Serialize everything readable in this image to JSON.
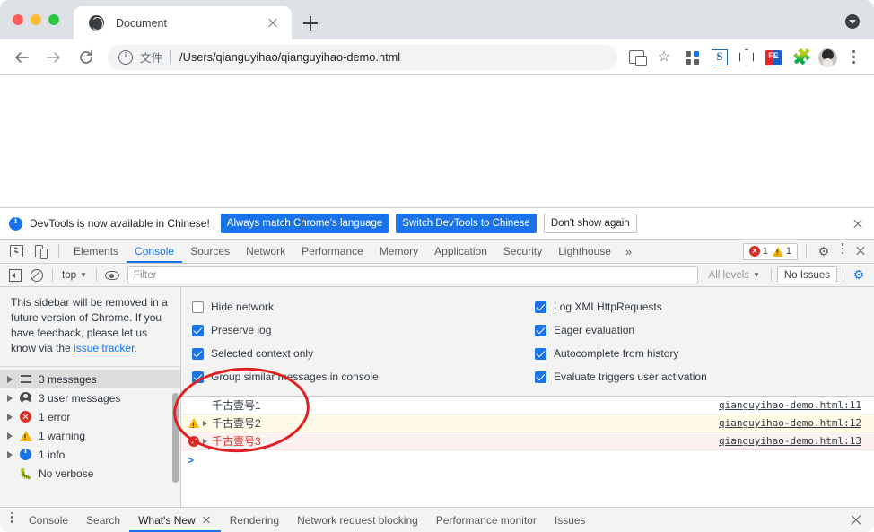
{
  "browser": {
    "tab": {
      "title": "Document",
      "favicon": "globe-icon",
      "close": "×"
    },
    "new_tab": "+",
    "window_menu": "window-menu-icon",
    "nav": {
      "back": "back-arrow-icon",
      "forward": "forward-arrow-icon",
      "reload": "reload-icon"
    },
    "omnibox": {
      "info_icon": "info-circle-icon",
      "scheme_label": "文件",
      "url": "/Users/qianguyihao/qianguyihao-demo.html"
    },
    "toolbar_icons": [
      {
        "name": "translate-icon"
      },
      {
        "name": "bookmark-star-icon"
      },
      {
        "name": "extension-grid-icon"
      },
      {
        "name": "s-extension-icon",
        "label": "S"
      },
      {
        "name": "hexagon-extension-icon"
      },
      {
        "name": "fe-extension-icon",
        "label": "FE"
      },
      {
        "name": "puzzle-extensions-icon"
      },
      {
        "name": "profile-avatar-icon"
      },
      {
        "name": "chrome-menu-icon"
      }
    ]
  },
  "devtools": {
    "banner": {
      "text": "DevTools is now available in Chinese!",
      "btn_primary": "Always match Chrome's language",
      "btn_secondary": "Switch DevTools to Chinese",
      "btn_dismiss": "Don't show again",
      "close": "×"
    },
    "tabs": [
      {
        "label": "Elements",
        "active": false
      },
      {
        "label": "Console",
        "active": true
      },
      {
        "label": "Sources",
        "active": false
      },
      {
        "label": "Network",
        "active": false
      },
      {
        "label": "Performance",
        "active": false
      },
      {
        "label": "Memory",
        "active": false
      },
      {
        "label": "Application",
        "active": false
      },
      {
        "label": "Security",
        "active": false
      },
      {
        "label": "Lighthouse",
        "active": false
      }
    ],
    "tabs_overflow": "»",
    "error_count": "1",
    "warning_count": "1",
    "filterbar": {
      "context": "top",
      "caret": "▼",
      "filter_placeholder": "Filter",
      "levels": "All levels",
      "levels_caret": "▼",
      "issues": "No Issues"
    },
    "sidebar": {
      "notice_part1": "This sidebar will be removed in a future version of Chrome. If you have feedback, please let us know via the ",
      "notice_link": "issue tracker",
      "notice_part2": ".",
      "items": [
        {
          "label": "3 messages",
          "icon": "list-icon",
          "selected": true,
          "expandable": true
        },
        {
          "label": "3 user messages",
          "icon": "user-icon",
          "selected": false,
          "expandable": true
        },
        {
          "label": "1 error",
          "icon": "error-icon",
          "selected": false,
          "expandable": true
        },
        {
          "label": "1 warning",
          "icon": "warning-icon",
          "selected": false,
          "expandable": true
        },
        {
          "label": "1 info",
          "icon": "info-icon",
          "selected": false,
          "expandable": true
        },
        {
          "label": "No verbose",
          "icon": "bug-icon",
          "selected": false,
          "expandable": false
        }
      ]
    },
    "settings": {
      "left": [
        {
          "label": "Hide network",
          "checked": false
        },
        {
          "label": "Preserve log",
          "checked": true
        },
        {
          "label": "Selected context only",
          "checked": true
        },
        {
          "label": "Group similar messages in console",
          "checked": true
        }
      ],
      "right": [
        {
          "label": "Log XMLHttpRequests",
          "checked": true
        },
        {
          "label": "Eager evaluation",
          "checked": true
        },
        {
          "label": "Autocomplete from history",
          "checked": true
        },
        {
          "label": "Evaluate triggers user activation",
          "checked": true
        }
      ]
    },
    "console_messages": [
      {
        "level": "log",
        "text": "千古壹号1",
        "source": "qianguyihao-demo.html:11",
        "expandable": false
      },
      {
        "level": "warn",
        "text": "千古壹号2",
        "source": "qianguyihao-demo.html:12",
        "expandable": true
      },
      {
        "level": "error",
        "text": "千古壹号3",
        "source": "qianguyihao-demo.html:13",
        "expandable": true
      }
    ],
    "prompt": ">",
    "drawer_tabs": [
      {
        "label": "Console",
        "active": false,
        "closable": false
      },
      {
        "label": "Search",
        "active": false,
        "closable": false
      },
      {
        "label": "What's New",
        "active": true,
        "closable": true
      },
      {
        "label": "Rendering",
        "active": false,
        "closable": false
      },
      {
        "label": "Network request blocking",
        "active": false,
        "closable": false
      },
      {
        "label": "Performance monitor",
        "active": false,
        "closable": false
      },
      {
        "label": "Issues",
        "active": false,
        "closable": false
      }
    ]
  },
  "annotation": {
    "shape": "red-ellipse",
    "color": "#e02020"
  }
}
